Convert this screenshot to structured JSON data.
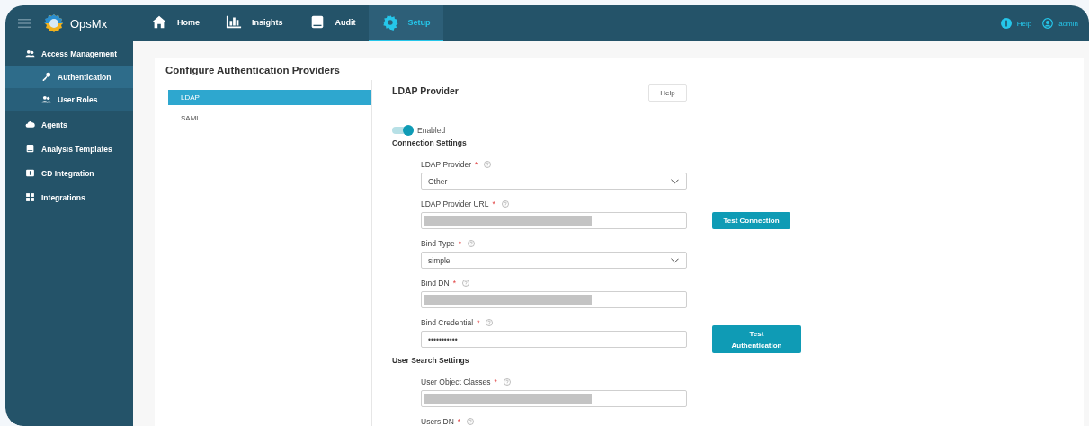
{
  "app": {
    "brand": "OpsMx"
  },
  "nav_tabs": [
    {
      "label": "Home",
      "kind": "home",
      "selected": false
    },
    {
      "label": "Insights",
      "kind": "chart",
      "selected": false
    },
    {
      "label": "Audit",
      "kind": "document",
      "selected": false
    },
    {
      "label": "Setup",
      "kind": "gear",
      "selected": true
    }
  ],
  "user_menu": {
    "help": "Help",
    "user": "admin"
  },
  "sidebar": {
    "items": [
      {
        "label": "Access Management",
        "kind": "users",
        "selected": false,
        "expanded": true,
        "children": [
          {
            "label": "Authentication",
            "kind": "key",
            "selected": true
          },
          {
            "label": "User Roles",
            "kind": "users",
            "selected": false
          }
        ]
      },
      {
        "label": "Agents",
        "kind": "cloud",
        "selected": false
      },
      {
        "label": "Analysis Templates",
        "kind": "document",
        "selected": false
      },
      {
        "label": "CD Integration",
        "kind": "plus",
        "selected": false
      },
      {
        "label": "Integrations",
        "kind": "grid",
        "selected": false
      }
    ]
  },
  "page": {
    "title": "Configure Authentication Providers",
    "providers": [
      {
        "label": "LDAP",
        "selected": true
      },
      {
        "label": "SAML",
        "selected": false
      }
    ],
    "panel": {
      "title": "LDAP Provider",
      "help_button": "Help",
      "enabled_toggle": {
        "label": "Enabled",
        "on": true
      },
      "sections": [
        {
          "title": "Connection Settings",
          "fields": [
            {
              "label": "LDAP Provider",
              "required_mark": "*",
              "kind": "select",
              "value": "Other"
            },
            {
              "label": "LDAP Provider URL",
              "required_mark": "*",
              "kind": "text",
              "redacted": true,
              "action": "Test Connection"
            },
            {
              "label": "Bind Type",
              "required_mark": "*",
              "kind": "select",
              "value": "simple"
            },
            {
              "label": "Bind DN",
              "required_mark": "*",
              "kind": "text",
              "redacted": true
            },
            {
              "label": "Bind Credential",
              "required_mark": "*",
              "kind": "text",
              "value": "•••••••••••",
              "action": "Test Authentication"
            }
          ]
        },
        {
          "title": "User Search Settings",
          "fields": [
            {
              "label": "User Object Classes",
              "required_mark": "*",
              "kind": "text",
              "redacted": true
            },
            {
              "label": "Users DN",
              "required_mark": "*",
              "kind": "label"
            }
          ]
        }
      ]
    }
  }
}
